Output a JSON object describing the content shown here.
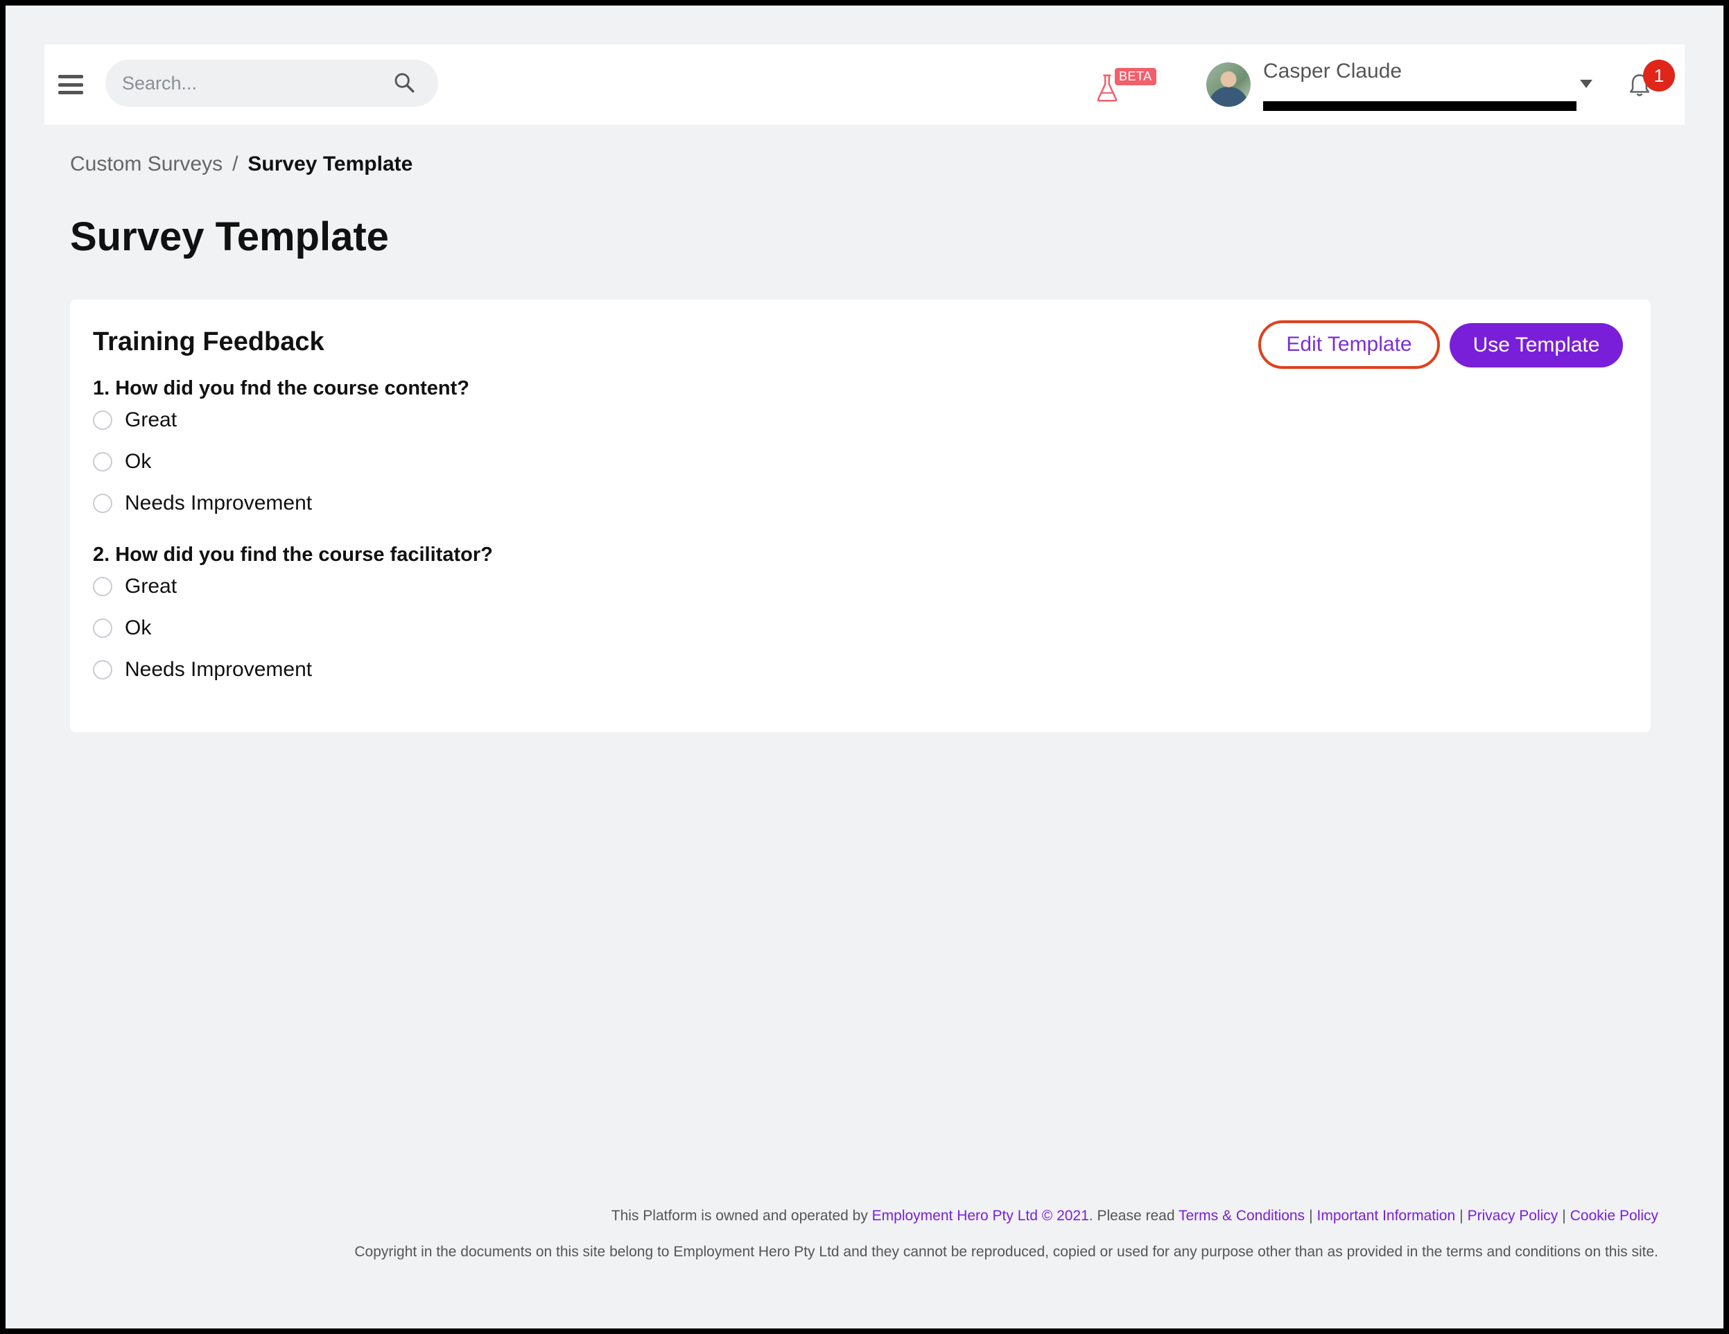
{
  "header": {
    "search_placeholder": "Search...",
    "beta_label": "BETA",
    "user_name": "Casper Claude",
    "notification_count": "1"
  },
  "breadcrumb": {
    "parent": "Custom Surveys",
    "separator": "/",
    "current": "Survey Template"
  },
  "page": {
    "title": "Survey Template"
  },
  "card": {
    "title": "Training Feedback",
    "edit_label": "Edit Template",
    "use_label": "Use Template",
    "questions": [
      {
        "text": "1. How did you fnd the course content?",
        "options": [
          "Great",
          "Ok",
          "Needs Improvement"
        ]
      },
      {
        "text": "2. How did you find the course facilitator?",
        "options": [
          "Great",
          "Ok",
          "Needs Improvement"
        ]
      }
    ]
  },
  "footer": {
    "intro": "This Platform is owned and operated by ",
    "company_link": "Employment Hero Pty Ltd © 2021",
    "please_read": ". Please read ",
    "terms": "Terms & Conditions",
    "important": "Important Information",
    "privacy": "Privacy Policy",
    "cookie": "Cookie Policy",
    "sep": "|",
    "copyright": "Copyright in the documents on this site belong to Employment Hero Pty Ltd and they cannot be reproduced, copied or used for any purpose other than as provided in the terms and conditions on this site."
  },
  "colors": {
    "accent": "#7a1fd9",
    "highlight_border": "#e0401f",
    "badge_red": "#e0251b",
    "beta_pink": "#f2606b",
    "background": "#f1f2f4"
  }
}
